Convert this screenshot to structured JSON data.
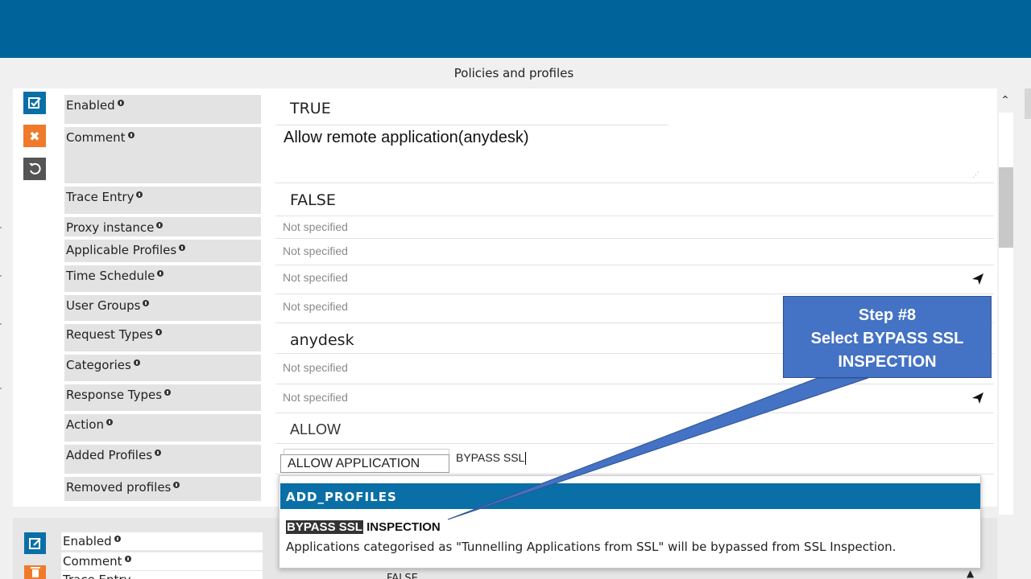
{
  "header": {
    "title": "Policies and profiles"
  },
  "actions": [
    {
      "name": "edit-check-icon"
    },
    {
      "name": "close-icon",
      "glyph": "✖"
    },
    {
      "name": "undo-icon"
    }
  ],
  "rule": {
    "enabled": {
      "label": "Enabled",
      "value": "TRUE"
    },
    "comment": {
      "label": "Comment",
      "value": "Allow remote application(anydesk)"
    },
    "trace_entry": {
      "label": "Trace Entry",
      "value": "FALSE"
    },
    "proxy_instance": {
      "label": "Proxy instance",
      "value": "Not specified"
    },
    "applicable_profiles": {
      "label": "Applicable Profiles",
      "value": "Not specified"
    },
    "time_schedule": {
      "label": "Time Schedule",
      "value": "Not specified"
    },
    "user_groups": {
      "label": "User Groups",
      "value": "Not specified"
    },
    "request_types": {
      "label": "Request Types",
      "value": "anydesk"
    },
    "categories": {
      "label": "Categories",
      "value": "Not specified"
    },
    "response_types": {
      "label": "Response Types",
      "value": "Not specified"
    },
    "action": {
      "label": "Action",
      "value": "ALLOW"
    },
    "added_profiles": {
      "label": "Added Profiles",
      "chip": "ALLOW APPLICATION",
      "input": "BYPASS SSL"
    },
    "removed_profiles": {
      "label": "Removed profiles"
    }
  },
  "dropdown": {
    "header": "ADD_PROFILES",
    "item_highlight": "BYPASS SSL",
    "item_rest": " INSPECTION",
    "item_desc": "Applications categorised as \"Tunnelling Applications from SSL\" will be bypassed from SSL Inspection."
  },
  "callout": {
    "line1": "Step #8",
    "line2": "Select BYPASS SSL",
    "line3": "INSPECTION"
  },
  "rule2": {
    "enabled": {
      "label": "Enabled"
    },
    "comment": {
      "label": "Comment"
    },
    "trace_entry": {
      "label": "Trace Entry",
      "value": "FALSE"
    }
  },
  "colors": {
    "brand": "#00649a",
    "accent_orange": "#f07a2b",
    "callout": "#4472c4"
  }
}
